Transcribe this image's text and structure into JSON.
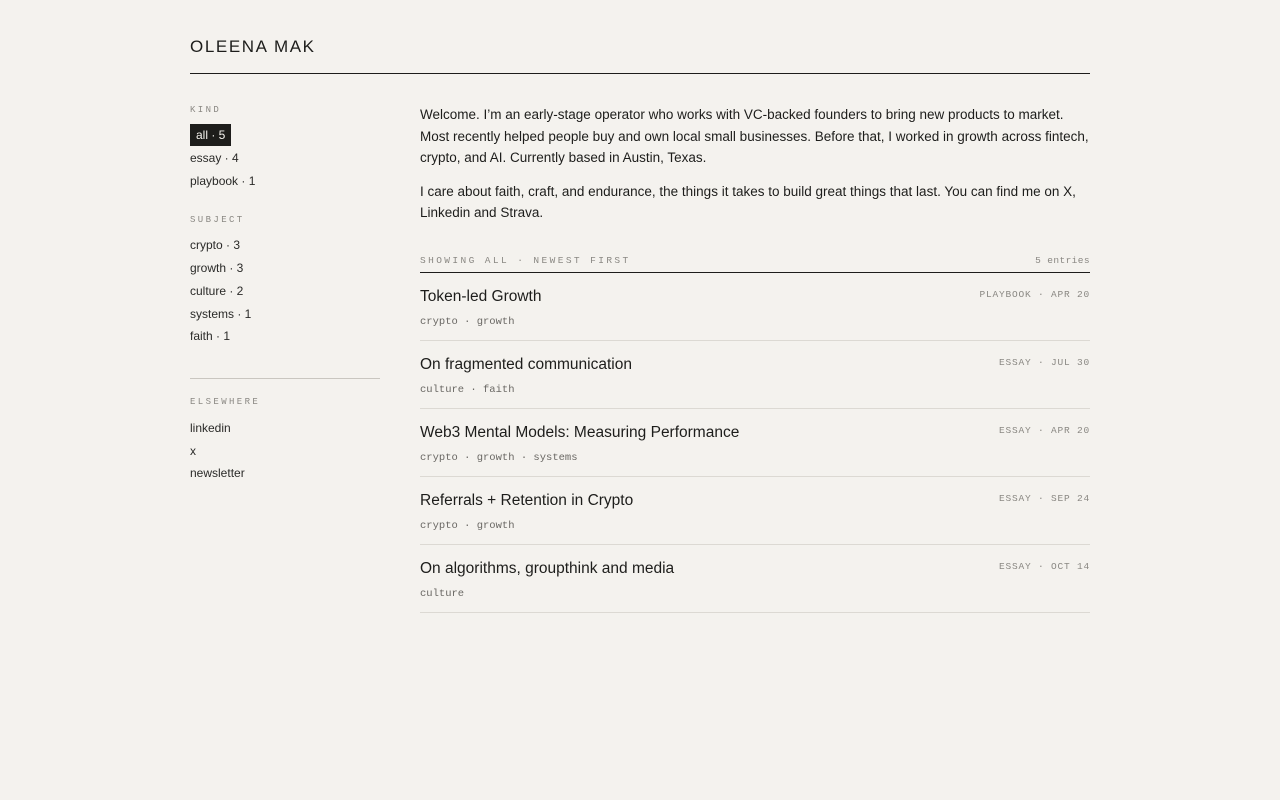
{
  "site": {
    "title": "OLEENA MAK"
  },
  "sidebar": {
    "kind_heading": "KIND",
    "kind_items": [
      {
        "label": "all · 5",
        "active": true
      },
      {
        "label": "essay · 4"
      },
      {
        "label": "playbook · 1"
      }
    ],
    "subject_heading": "SUBJECT",
    "subject_items": [
      {
        "label": "crypto · 3"
      },
      {
        "label": "growth · 3"
      },
      {
        "label": "culture · 2"
      },
      {
        "label": "systems · 1"
      },
      {
        "label": "faith · 1"
      }
    ],
    "elsewhere_heading": "ELSEWHERE",
    "elsewhere_items": [
      {
        "label": "linkedin"
      },
      {
        "label": "x"
      },
      {
        "label": "newsletter"
      }
    ]
  },
  "intro": {
    "p1": "Welcome. I’m an early-stage operator who works with VC-backed founders to bring new products to market. Most recently helped people buy and own local small businesses. Before that, I worked in growth across fintech, crypto, and AI. Currently based in Austin, Texas.",
    "p2": "I care about faith, craft, and endurance, the things it takes to build great things that last. You can find me on X, Linkedin and Strava."
  },
  "list": {
    "status": "SHOWING ALL · NEWEST FIRST",
    "count": "5 entries",
    "entries": [
      {
        "title": "Token-led Growth",
        "meta": "PLAYBOOK · APR 20",
        "tags": "crypto · growth"
      },
      {
        "title": "On fragmented communication",
        "meta": "ESSAY · JUL 30",
        "tags": "culture · faith"
      },
      {
        "title": "Web3 Mental Models: Measuring Performance",
        "meta": "ESSAY · APR 20",
        "tags": "crypto · growth · systems"
      },
      {
        "title": "Referrals + Retention in Crypto",
        "meta": "ESSAY · SEP 24",
        "tags": "crypto · growth"
      },
      {
        "title": "On algorithms, groupthink and media",
        "meta": "ESSAY · OCT 14",
        "tags": "culture"
      }
    ]
  },
  "colors": {
    "background": "#f4f2ee",
    "ink": "#1d1d1b",
    "muted": "#8a8883"
  }
}
